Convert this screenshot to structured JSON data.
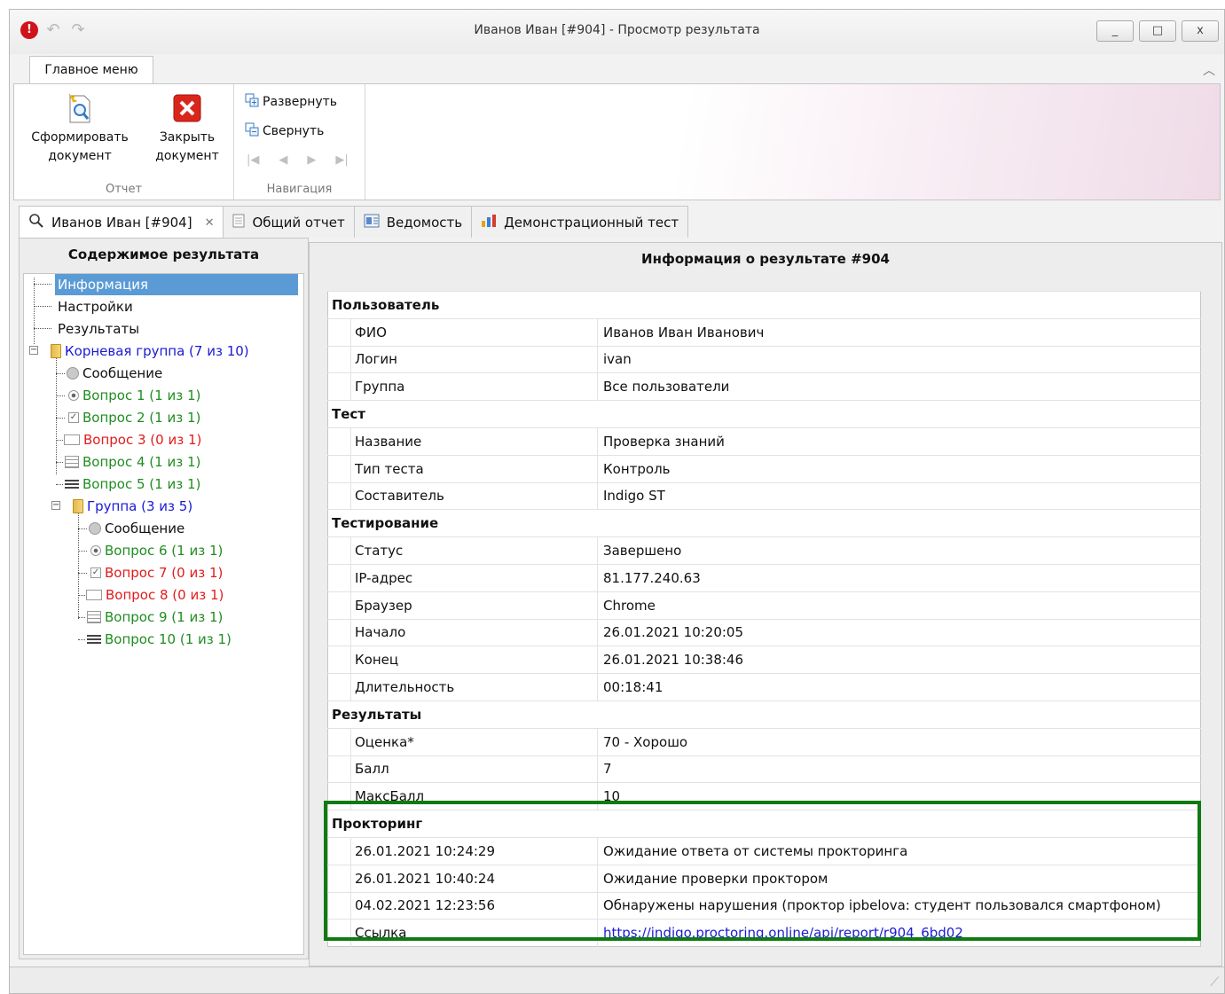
{
  "window": {
    "title": "Иванов Иван [#904] - Просмотр результата",
    "controls": [
      "_",
      "□",
      "x"
    ]
  },
  "ribbon": {
    "tab": "Главное меню",
    "groups": {
      "report": {
        "label": "Отчет",
        "form_line1": "Сформировать",
        "form_line2": "документ",
        "close_line1": "Закрыть",
        "close_line2": "документ"
      },
      "navigation": {
        "label": "Навигация",
        "expand": "Развернуть",
        "collapse": "Свернуть"
      }
    }
  },
  "tabs": [
    {
      "label": "Иванов Иван [#904]",
      "icon": "search-icon"
    },
    {
      "label": "Общий отчет",
      "icon": "document-icon"
    },
    {
      "label": "Ведомость",
      "icon": "sheet-icon"
    },
    {
      "label": "Демонстрационный тест",
      "icon": "chart-icon"
    }
  ],
  "left_panel": {
    "title": "Содержимое результата",
    "tree": [
      {
        "label": "Информация",
        "selected": true
      },
      {
        "label": "Настройки"
      },
      {
        "label": "Результаты"
      },
      {
        "label": "Корневая группа (7 из 10)",
        "color": "#1a1ad4"
      },
      {
        "label": "Сообщение"
      },
      {
        "label": "Вопрос 1 (1 из 1)",
        "color": "#208d20"
      },
      {
        "label": "Вопрос 2 (1 из 1)",
        "color": "#208d20"
      },
      {
        "label": "Вопрос 3 (0 из 1)",
        "color": "#e21b1b"
      },
      {
        "label": "Вопрос 4 (1 из 1)",
        "color": "#208d20"
      },
      {
        "label": "Вопрос 5 (1 из 1)",
        "color": "#208d20"
      },
      {
        "label": "Группа (3 из 5)",
        "color": "#1a1ad4"
      },
      {
        "label": "Сообщение"
      },
      {
        "label": "Вопрос 6 (1 из 1)",
        "color": "#208d20"
      },
      {
        "label": "Вопрос 7 (0 из 1)",
        "color": "#e21b1b"
      },
      {
        "label": "Вопрос 8 (0 из 1)",
        "color": "#e21b1b"
      },
      {
        "label": "Вопрос 9 (1 из 1)",
        "color": "#208d20"
      },
      {
        "label": "Вопрос 10 (1 из 1)",
        "color": "#208d20"
      }
    ]
  },
  "right_panel": {
    "title": "Информация о результате #904",
    "sections": [
      {
        "title": "Пользователь",
        "rows": [
          [
            "ФИО",
            "Иванов Иван Иванович"
          ],
          [
            "Логин",
            "ivan"
          ],
          [
            "Группа",
            "Все пользователи"
          ]
        ]
      },
      {
        "title": "Тест",
        "rows": [
          [
            "Название",
            "Проверка знаний"
          ],
          [
            "Тип теста",
            "Контроль"
          ],
          [
            "Составитель",
            "Indigo ST"
          ]
        ]
      },
      {
        "title": "Тестирование",
        "rows": [
          [
            "Статус",
            "Завершено"
          ],
          [
            "IP-адрес",
            "81.177.240.63"
          ],
          [
            "Браузер",
            "Chrome"
          ],
          [
            "Начало",
            "26.01.2021 10:20:05"
          ],
          [
            "Конец",
            "26.01.2021 10:38:46"
          ],
          [
            "Длительность",
            "00:18:41"
          ]
        ]
      },
      {
        "title": "Результаты",
        "rows": [
          [
            "Оценка*",
            "70 - Хорошо"
          ],
          [
            "Балл",
            "7"
          ],
          [
            "МаксБалл",
            "10"
          ]
        ]
      },
      {
        "title": "Прокторинг",
        "rows": [
          [
            "26.01.2021 10:24:29",
            "Ожидание ответа от системы прокторинга"
          ],
          [
            "26.01.2021 10:40:24",
            "Ожидание проверки проктором"
          ],
          [
            "04.02.2021 12:23:56",
            "Обнаружены нарушения (проктор ipbelova: студент пользовался смартфоном)"
          ],
          [
            "Ссылка",
            "https://indigo.proctoring.online/api/report/r904_6bd02"
          ]
        ]
      }
    ]
  },
  "colors": {
    "selection": "#5b9bd5",
    "highlight_border": "#0f7a12",
    "group": "#1a1ad4",
    "correct": "#208d20",
    "wrong": "#e21b1b"
  }
}
